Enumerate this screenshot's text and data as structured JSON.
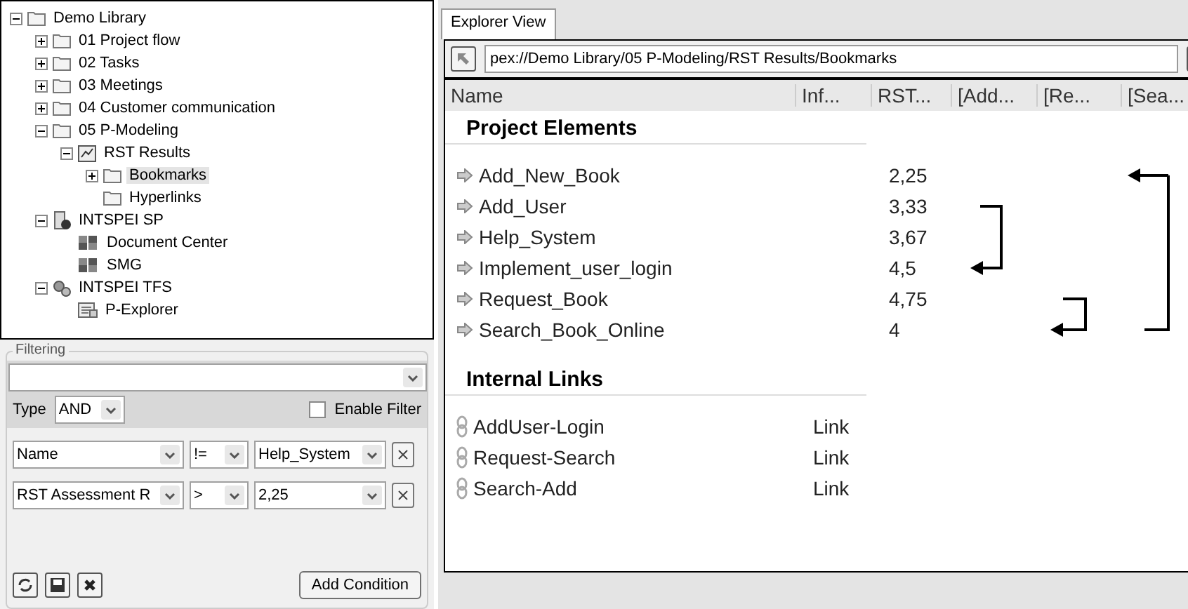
{
  "tree": [
    {
      "label": "Demo Library",
      "kind": "folder",
      "expanded": true,
      "selected": false,
      "children": [
        {
          "label": "01 Project flow",
          "kind": "folder",
          "expanded": false,
          "selected": false
        },
        {
          "label": "02 Tasks",
          "kind": "folder",
          "expanded": false,
          "selected": false
        },
        {
          "label": "03 Meetings",
          "kind": "folder",
          "expanded": false,
          "selected": false
        },
        {
          "label": "04 Customer communication",
          "kind": "folder",
          "expanded": false,
          "selected": false
        },
        {
          "label": "05 P-Modeling",
          "kind": "folder",
          "expanded": true,
          "selected": false,
          "children": [
            {
              "label": "RST Results",
              "kind": "report",
              "expanded": true,
              "selected": false,
              "children": [
                {
                  "label": "Bookmarks",
                  "kind": "folder",
                  "expanded": false,
                  "selected": true
                },
                {
                  "label": "Hyperlinks",
                  "kind": "folder",
                  "selected": false
                }
              ]
            }
          ]
        },
        {
          "label": "INTSPEI SP",
          "kind": "server",
          "expanded": true,
          "selected": false,
          "children": [
            {
              "label": "Document Center",
              "kind": "site",
              "selected": false
            },
            {
              "label": "SMG",
              "kind": "site",
              "selected": false
            }
          ]
        },
        {
          "label": "INTSPEI TFS",
          "kind": "tfs",
          "expanded": true,
          "selected": false,
          "children": [
            {
              "label": "P-Explorer",
              "kind": "explorer",
              "selected": false
            }
          ]
        }
      ]
    }
  ],
  "filtering": {
    "title": "Filtering",
    "type_label": "Type",
    "type_value": "AND",
    "enable_filter": {
      "label": "Enable Filter",
      "checked": false
    },
    "conditions": [
      {
        "field": "Name",
        "operator": "!=",
        "value": "Help_System"
      },
      {
        "field": "RST Assessment R",
        "operator": ">",
        "value": "2,25"
      }
    ],
    "add_button": "Add Condition"
  },
  "explorer": {
    "tab": "Explorer View",
    "address": "pex://Demo Library/05 P-Modeling/RST Results/Bookmarks",
    "columns": [
      "Name",
      "Inf...",
      "RST...",
      "[Add...",
      "[Re...",
      "[Sea..."
    ],
    "sections": [
      {
        "title": "Project Elements",
        "kind": "element",
        "rows": [
          {
            "name": "Add_New_Book",
            "rst": "2,25"
          },
          {
            "name": "Add_User",
            "rst": "3,33"
          },
          {
            "name": "Help_System",
            "rst": "3,67"
          },
          {
            "name": "Implement_user_login",
            "rst": "4,5"
          },
          {
            "name": "Request_Book",
            "rst": "4,75"
          },
          {
            "name": "Search_Book_Online",
            "rst": "4"
          }
        ]
      },
      {
        "title": "Internal Links",
        "kind": "link",
        "rows": [
          {
            "name": "AddUser-Login",
            "inf": "Link"
          },
          {
            "name": "Request-Search",
            "inf": "Link"
          },
          {
            "name": "Search-Add",
            "inf": "Link"
          }
        ]
      }
    ]
  }
}
